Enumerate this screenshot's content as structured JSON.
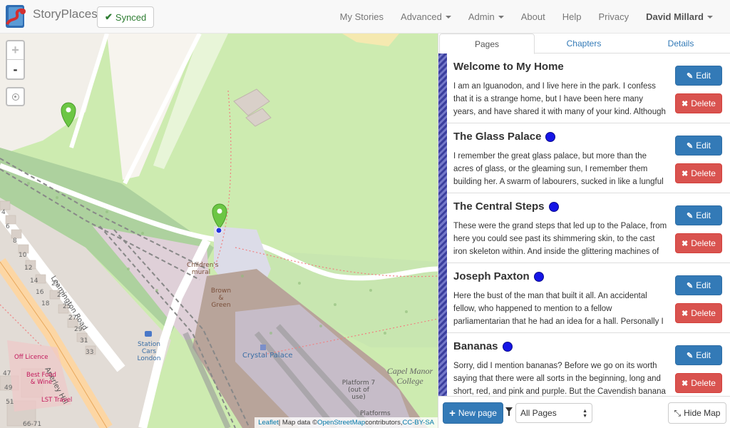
{
  "brand": {
    "name": "StoryPlaces",
    "logo_icon": "storyplaces-logo-icon"
  },
  "status": {
    "synced_label": "Synced"
  },
  "nav": {
    "my_stories": "My Stories",
    "advanced": "Advanced",
    "admin": "Admin",
    "about": "About",
    "help": "Help",
    "privacy": "Privacy",
    "user": "David Millard"
  },
  "map": {
    "zoom_in": "+",
    "zoom_out": "-",
    "labels": {
      "leamington_road": "Leamington Road",
      "childrens_mural": "Children's mural",
      "brown_green": "Brown & Green",
      "station_cars": "Station Cars London",
      "crystal_palace": "Crystal Palace",
      "capel_manor": "Capel Manor College",
      "platform7": "Platform 7 (out of use)",
      "platforms": "Platforms",
      "anerley_hill": "Anerley Hill",
      "off_licence": "Off Licence",
      "best_food": "Best Food & Wine",
      "lst_travel": "LST Travel"
    },
    "house_numbers": [
      "4",
      "6",
      "8",
      "10",
      "12",
      "14",
      "16",
      "18",
      "21",
      "23",
      "25",
      "27",
      "29",
      "31",
      "33",
      "47",
      "49",
      "51",
      "66-71"
    ],
    "attribution": {
      "leaflet": "Leaflet",
      "sep": " | Map data © ",
      "osm": "OpenStreetMap",
      "contributors": " contributors, ",
      "license": "CC-BY-SA"
    },
    "colors": {
      "park": "#cdebb0",
      "wood": "#add19e",
      "railway": "#dfd0d8",
      "buildings": "#b8a49a",
      "marker": "#6cc644",
      "pink": "#f0b7b7"
    }
  },
  "tabs": {
    "pages": "Pages",
    "chapters": "Chapters",
    "details": "Details"
  },
  "pages": [
    {
      "title": "Welcome to My Home",
      "dot": false,
      "text": "I am an Iguanodon, and I live here in the park. I confess that it is a strange home, but I have been here many years, and have shared it with many of your kind. Although the visitors"
    },
    {
      "title": "The Glass Palace",
      "dot": true,
      "text": "I remember the great glass palace, but more than the acres of glass, or the gleaming sun, I remember them building her. A swarm of labourers, sucked in like a lungful of air with"
    },
    {
      "title": "The Central Steps",
      "dot": true,
      "text": "These were the grand steps that led up to the Palace, from here you could see past its shimmering skin, to the cast iron skeleton within. And inside the glittering machines of the"
    },
    {
      "title": "Joseph Paxton",
      "dot": true,
      "text": "Here the bust of the man that built it all. An accidental fellow, who happened to mention to a fellow parliamentarian that he had an idea for a hall. Personally I rate Paxton, not for his"
    },
    {
      "title": "Bananas",
      "dot": true,
      "text": "Sorry, did I mention bananas? Before we go on its worth saying that there were all sorts in the beginning, long and short, red, and pink and purple. But the Cavendish banana is"
    }
  ],
  "page_buttons": {
    "edit": "Edit",
    "delete": "Delete"
  },
  "footer": {
    "new_page": "New page",
    "filter_value": "All Pages",
    "hide_map": "Hide Map"
  }
}
